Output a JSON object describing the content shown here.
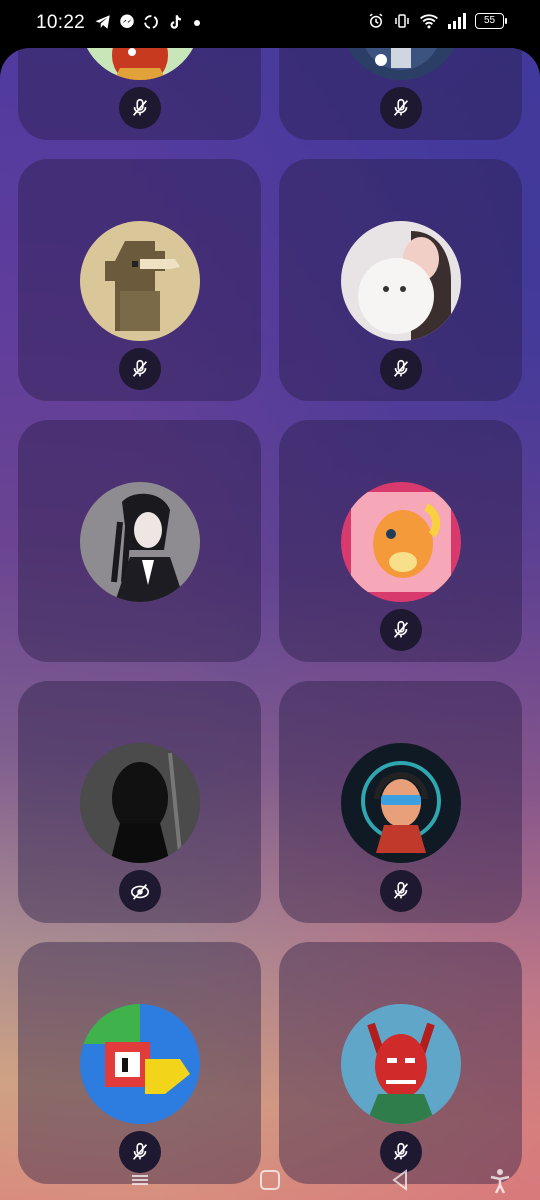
{
  "status_bar": {
    "time": "10:22",
    "left_icons": [
      "telegram-icon",
      "messenger-icon",
      "sync-icon",
      "tiktok-icon",
      "notification-dot"
    ],
    "right_icons": [
      "alarm-icon",
      "vibrate-icon",
      "wifi-icon",
      "signal-icon"
    ],
    "battery": "55"
  },
  "grid": {
    "tiles": [
      {
        "name": "tile-participant-1",
        "avatar": "avatar-red-creature",
        "mic": "muted"
      },
      {
        "name": "tile-participant-2",
        "avatar": "avatar-dark-character",
        "mic": "muted"
      },
      {
        "name": "tile-participant-3",
        "avatar": "avatar-plague-doctor",
        "mic": "muted"
      },
      {
        "name": "tile-participant-4",
        "avatar": "avatar-girl-with-dog",
        "mic": "muted"
      },
      {
        "name": "tile-participant-5",
        "avatar": "avatar-braided-girl",
        "mic": "none"
      },
      {
        "name": "tile-participant-6",
        "avatar": "avatar-charmander",
        "mic": "muted"
      },
      {
        "name": "tile-participant-7",
        "avatar": "avatar-dark-figure",
        "mic": "camera-off"
      },
      {
        "name": "tile-participant-8",
        "avatar": "avatar-headphones-guy",
        "mic": "muted"
      },
      {
        "name": "tile-participant-9",
        "avatar": "avatar-blocky-logo",
        "mic": "muted"
      },
      {
        "name": "tile-participant-10",
        "avatar": "avatar-red-demon",
        "mic": "muted"
      }
    ]
  },
  "colors": {
    "tile_bg": "#281c46",
    "mic_bg": "#1e1830",
    "icon": "#ffffff"
  }
}
